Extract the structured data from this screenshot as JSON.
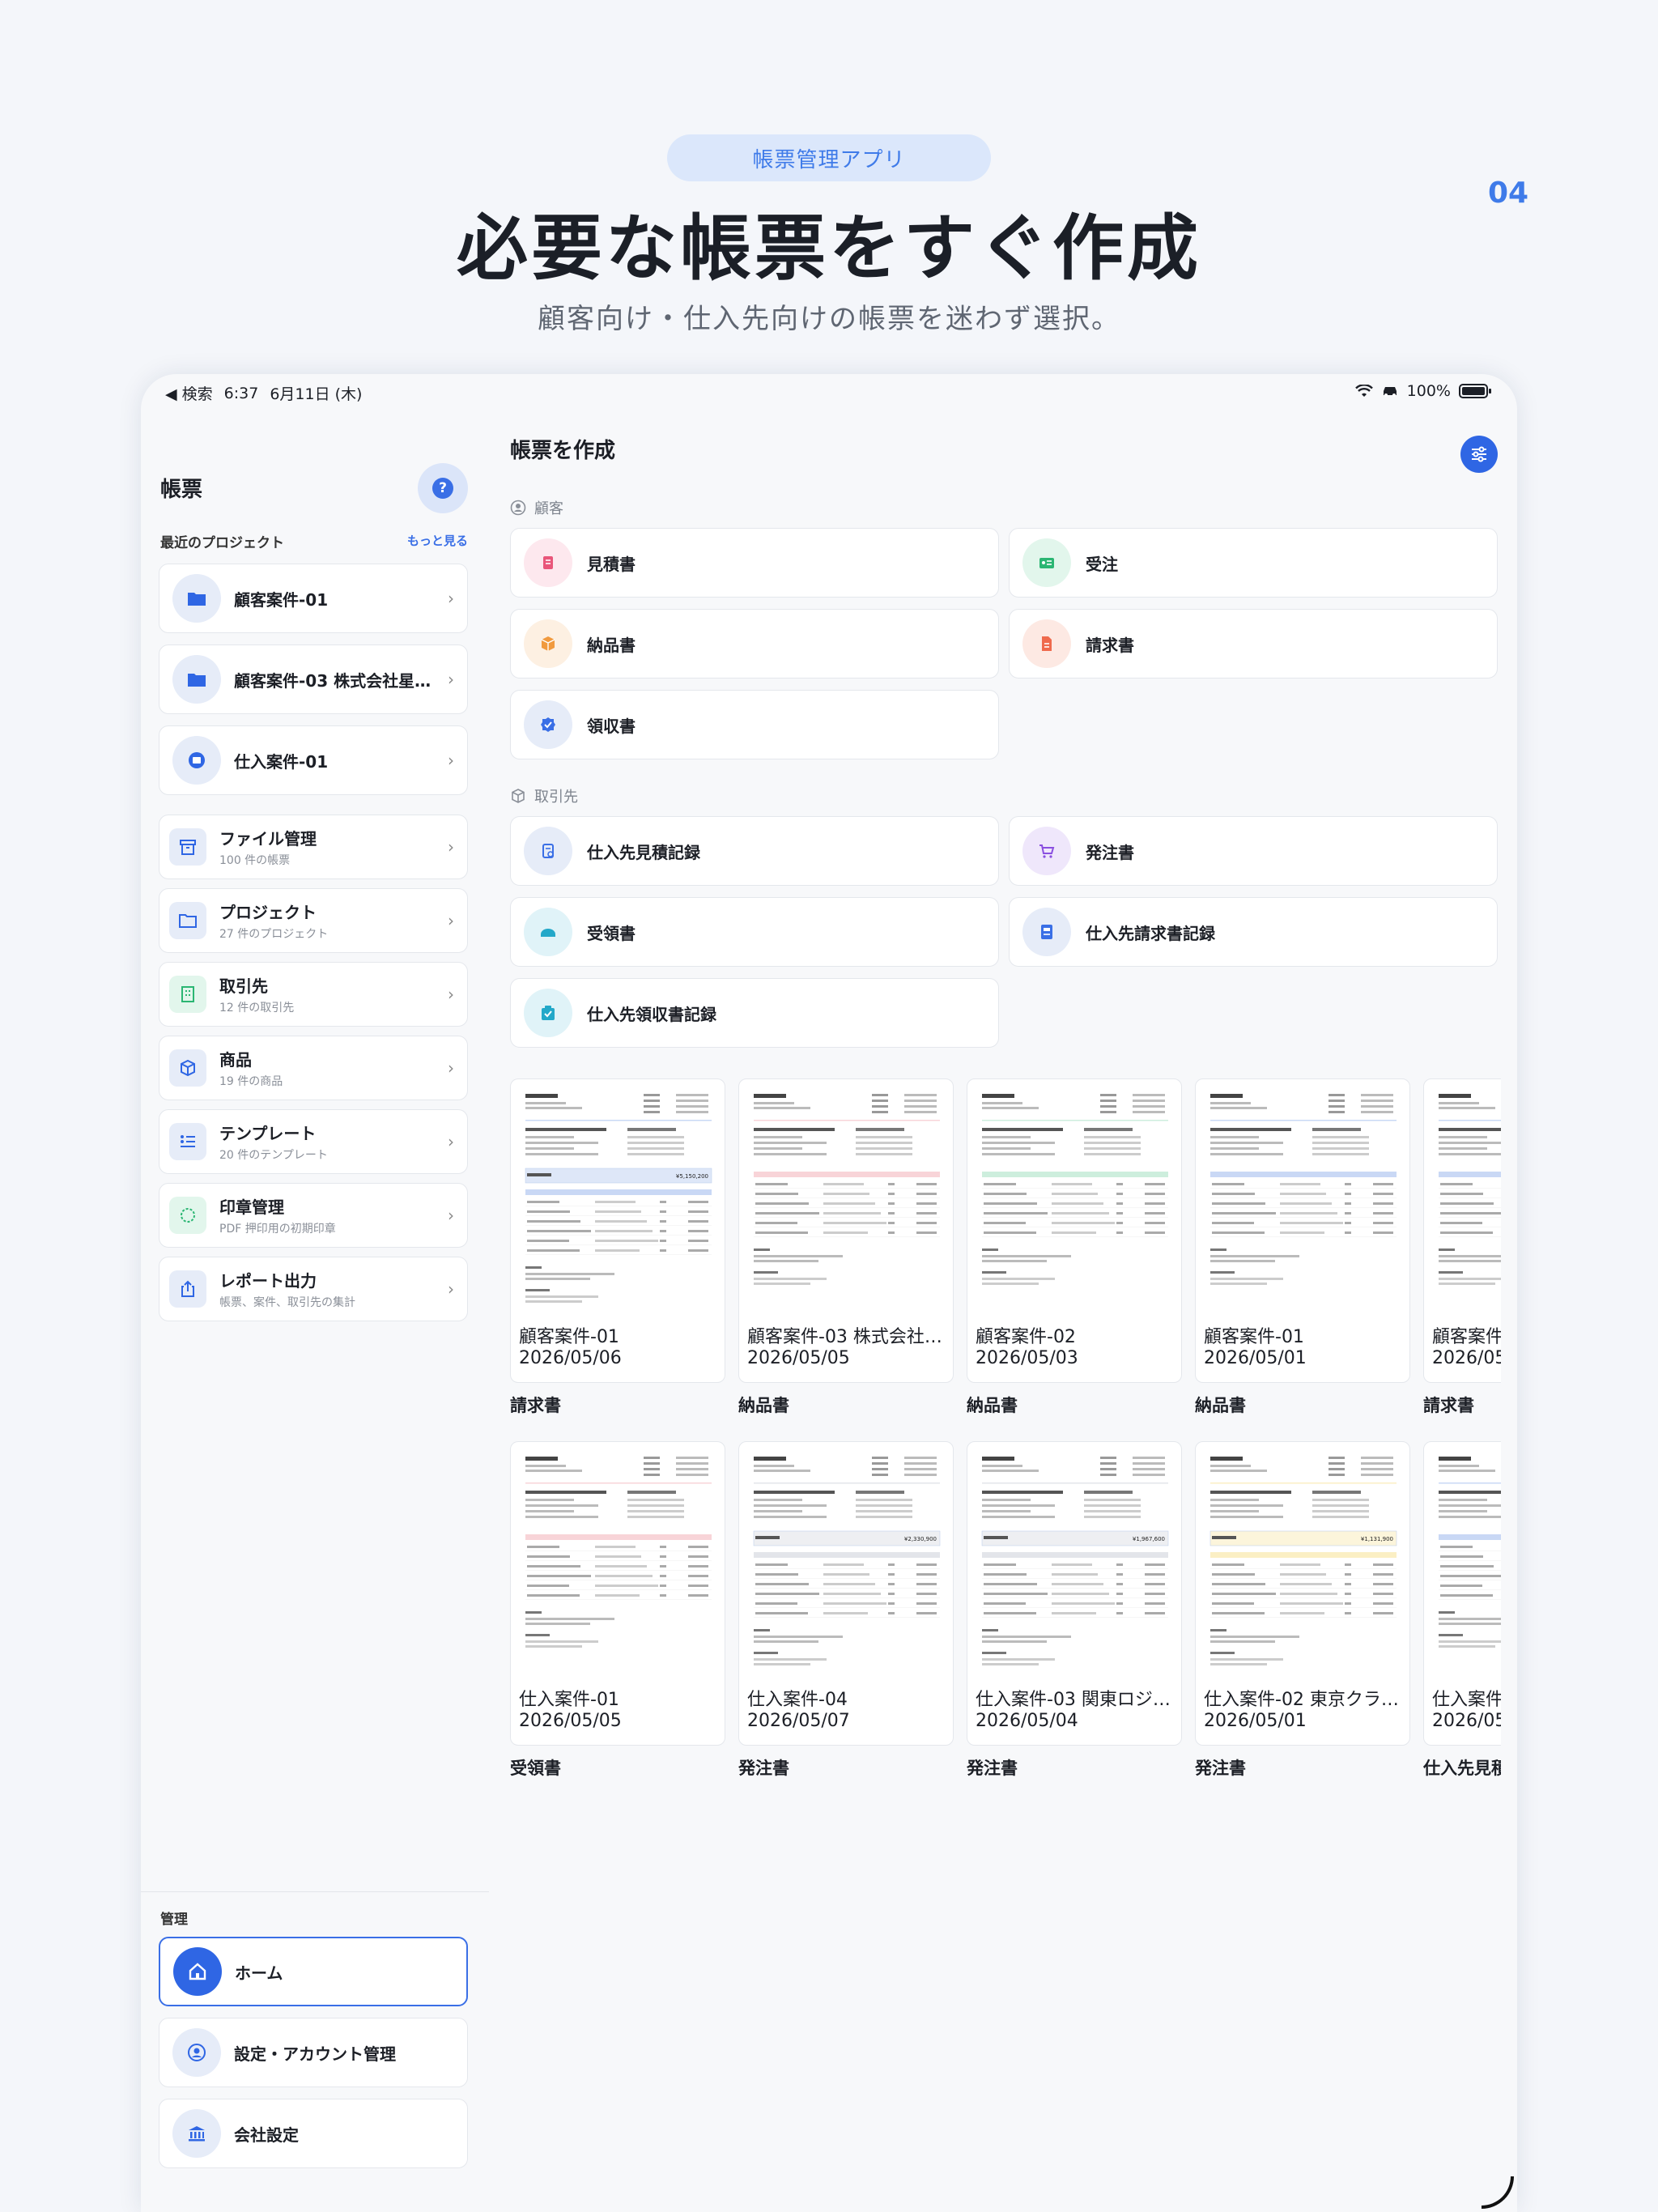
{
  "promo": {
    "pill": "帳票管理アプリ",
    "number": "04",
    "title": "必要な帳票をすぐ作成",
    "subtitle": "顧客向け・仕入先向けの帳票を迷わず選択。"
  },
  "status": {
    "back": "◀ 検索",
    "time": "6:37",
    "date": "6月11日 (木)",
    "battery": "100%",
    "battery_level": 1.0
  },
  "sidebar": {
    "title": "帳票",
    "help": "?",
    "recent_label": "最近のプロジェクト",
    "more": "もっと見る",
    "recent": [
      {
        "label": "顧客案件-01"
      },
      {
        "label": "顧客案件-03 株式会社星…"
      },
      {
        "label": "仕入案件-01"
      }
    ],
    "menu": [
      {
        "label": "ファイル管理",
        "sub": "100 件の帳票"
      },
      {
        "label": "プロジェクト",
        "sub": "27 件のプロジェクト"
      },
      {
        "label": "取引先",
        "sub": "12 件の取引先"
      },
      {
        "label": "商品",
        "sub": "19 件の商品"
      },
      {
        "label": "テンプレート",
        "sub": "20 件のテンプレート"
      },
      {
        "label": "印章管理",
        "sub": "PDF 押印用の初期印章"
      },
      {
        "label": "レポート出力",
        "sub": "帳票、案件、取引先の集計"
      }
    ],
    "admin_label": "管理",
    "admin": [
      {
        "label": "ホーム"
      },
      {
        "label": "設定・アカウント管理"
      },
      {
        "label": "会社設定"
      }
    ]
  },
  "main": {
    "title": "帳票を作成",
    "customer_section": "顧客",
    "customer_docs": [
      {
        "label": "見積書",
        "color": "#e9567a",
        "bg": "#fde8ee"
      },
      {
        "label": "受注",
        "color": "#2bb673",
        "bg": "#e2f6ec"
      },
      {
        "label": "納品書",
        "color": "#f19a3e",
        "bg": "#fdf0e2"
      },
      {
        "label": "請求書",
        "color": "#ef6a4d",
        "bg": "#fde9e3"
      },
      {
        "label": "領収書",
        "color": "#3a6fe6",
        "bg": "#e6ecf8"
      }
    ],
    "supplier_section": "取引先",
    "supplier_docs": [
      {
        "label": "仕入先見積記録",
        "color": "#3a6fe6",
        "bg": "#e6ecf8"
      },
      {
        "label": "発注書",
        "color": "#8a4fe0",
        "bg": "#efe7fb"
      },
      {
        "label": "受領書",
        "color": "#23a8c9",
        "bg": "#e0f3f8"
      },
      {
        "label": "仕入先請求書記録",
        "color": "#3a6fe6",
        "bg": "#e6ecf8"
      },
      {
        "label": "仕入先領収書記録",
        "color": "#23a8c9",
        "bg": "#e0f3f8"
      }
    ],
    "recent_docs_row1": [
      {
        "name": "顧客案件-01",
        "date": "2026/05/06",
        "type": "請求書",
        "accent": "#c9d8f5",
        "total": "¥5,150,200"
      },
      {
        "name": "顧客案件-03 株式会社…",
        "date": "2026/05/05",
        "type": "納品書",
        "accent": "#f8d4d8",
        "total": ""
      },
      {
        "name": "顧客案件-02",
        "date": "2026/05/03",
        "type": "納品書",
        "accent": "#cdeedd",
        "total": ""
      },
      {
        "name": "顧客案件-01",
        "date": "2026/05/01",
        "type": "納品書",
        "accent": "#c9d8f5",
        "total": ""
      },
      {
        "name": "顧客案件-",
        "date": "2026/05",
        "type": "請求書",
        "accent": "#c9d8f5",
        "total": ""
      }
    ],
    "recent_docs_row2": [
      {
        "name": "仕入案件-01",
        "date": "2026/05/05",
        "type": "受領書",
        "accent": "#f8d4d8",
        "total": ""
      },
      {
        "name": "仕入案件-04",
        "date": "2026/05/07",
        "type": "発注書",
        "accent": "#e3e5ea",
        "total": "¥2,330,900"
      },
      {
        "name": "仕入案件-03 関東ロジ…",
        "date": "2026/05/04",
        "type": "発注書",
        "accent": "#e3e5ea",
        "total": "¥1,967,600"
      },
      {
        "name": "仕入案件-02 東京クラ…",
        "date": "2026/05/01",
        "type": "発注書",
        "accent": "#fbefc4",
        "total": "¥1,131,900"
      },
      {
        "name": "仕入案件-",
        "date": "2026/05",
        "type": "仕入先見積",
        "accent": "#c9d8f5",
        "total": ""
      }
    ]
  }
}
